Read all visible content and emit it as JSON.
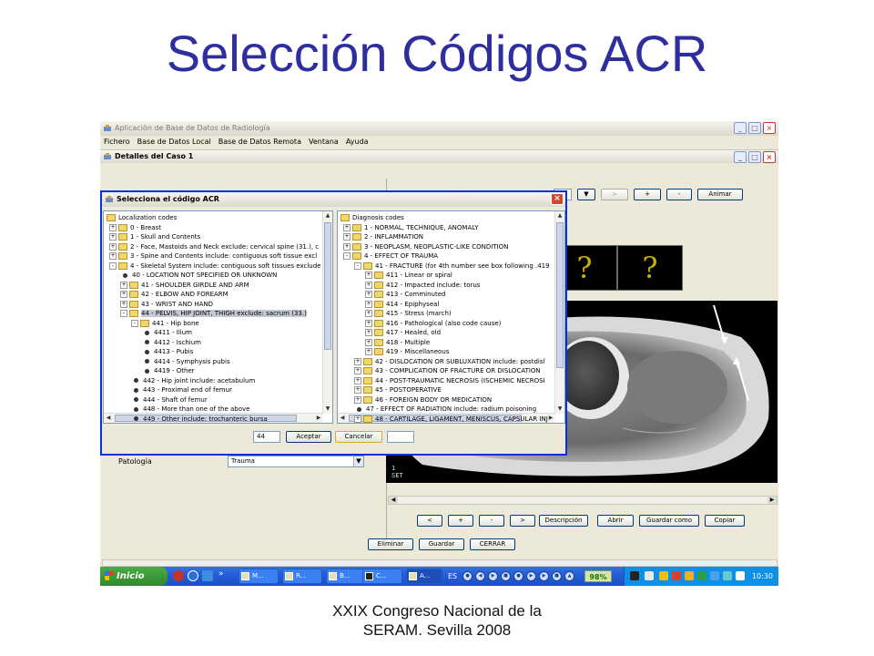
{
  "slide": {
    "title": "Selección Códigos ACR",
    "footer_line1": "XXIX Congreso Nacional de la",
    "footer_line2": "SERAM. Sevilla 2008"
  },
  "app": {
    "title": "Aplicación de Base de Datos de Radiología",
    "menu": [
      "Fichero",
      "Base de Datos Local",
      "Base de Datos Remota",
      "Ventana",
      "Ayuda"
    ],
    "window_buttons": {
      "minimize": "_",
      "maximize": "□",
      "close": "×"
    }
  },
  "case_window": {
    "title": "Detalles del Caso 1",
    "patologia_label": "Patología",
    "patologia_value": "Trauma",
    "image_toolbar": {
      "select_value": "ip",
      "buttons": [
        ">",
        "+",
        "-",
        "Animar"
      ]
    },
    "thumbnails": [
      "?",
      "?"
    ],
    "mri_overlay": "1\nSET",
    "nav_buttons": [
      "<",
      "+",
      "-",
      ">",
      "Descripción",
      "Abrir",
      "Guardar como",
      "Copiar"
    ],
    "bottom_buttons": [
      "Eliminar",
      "Guardar",
      "CERRAR"
    ]
  },
  "dialog": {
    "title": "Selecciona el código ACR",
    "close_label": "×",
    "localization_tree": [
      {
        "text": "Localization codes",
        "level": 0,
        "kind": "root"
      },
      {
        "text": "0 - Breast",
        "level": 1,
        "kind": "folder",
        "toggle": "+"
      },
      {
        "text": "1 - Skull and Contents",
        "level": 1,
        "kind": "folder",
        "toggle": "+"
      },
      {
        "text": "2 - Face, Mastoids and Neck  exclude: cervical spine (31.), c",
        "level": 1,
        "kind": "folder",
        "toggle": "+"
      },
      {
        "text": "3 - Spine and Contents include: contiguous soft tissue   excl",
        "level": 1,
        "kind": "folder",
        "toggle": "+"
      },
      {
        "text": "4 - Skeletal System include: contiguous soft tissues   exclude",
        "level": 1,
        "kind": "folder",
        "toggle": "-"
      },
      {
        "text": "40 - LOCATION NOT SPECIFIED OR UNKNOWN",
        "level": 2,
        "kind": "leaf"
      },
      {
        "text": "41 - SHOULDER GIRDLE AND ARM",
        "level": 2,
        "kind": "folder",
        "toggle": "+"
      },
      {
        "text": "42 - ELBOW AND FOREARM",
        "level": 2,
        "kind": "folder",
        "toggle": "+"
      },
      {
        "text": "43 - WRIST AND HAND",
        "level": 2,
        "kind": "folder",
        "toggle": "+"
      },
      {
        "text": "44 - PELVIS, HIP JOINT, THIGH    exclude: sacrum (33.)",
        "level": 2,
        "kind": "folder",
        "toggle": "-",
        "selected": true
      },
      {
        "text": "441 - Hip bone",
        "level": 3,
        "kind": "folder",
        "toggle": "-"
      },
      {
        "text": "4411 - Ilium",
        "level": 4,
        "kind": "leaf"
      },
      {
        "text": "4412 - Ischium",
        "level": 4,
        "kind": "leaf"
      },
      {
        "text": "4413 - Pubis",
        "level": 4,
        "kind": "leaf"
      },
      {
        "text": "4414 - Symphysis pubis",
        "level": 4,
        "kind": "leaf"
      },
      {
        "text": "4419 - Other",
        "level": 4,
        "kind": "leaf"
      },
      {
        "text": "442 - Hip joint    include: acetabulum",
        "level": 3,
        "kind": "leaf"
      },
      {
        "text": "443 - Proximal end of femur",
        "level": 3,
        "kind": "leaf"
      },
      {
        "text": "444 - Shaft of femur",
        "level": 3,
        "kind": "leaf"
      },
      {
        "text": "448 - More than one of the above",
        "level": 3,
        "kind": "leaf"
      },
      {
        "text": "449 - Other    include: trochanteric bursa",
        "level": 3,
        "kind": "leaf"
      }
    ],
    "diagnosis_tree": [
      {
        "text": "Diagnosis codes",
        "level": 0,
        "kind": "root"
      },
      {
        "text": "1 - NORMAL, TECHNIQUE, ANOMALY",
        "level": 1,
        "kind": "folder",
        "toggle": "+"
      },
      {
        "text": "2 - INFLAMMATION",
        "level": 1,
        "kind": "folder",
        "toggle": "+"
      },
      {
        "text": "3 - NEOPLASM, NEOPLASTIC-LIKE CONDITION",
        "level": 1,
        "kind": "folder",
        "toggle": "+"
      },
      {
        "text": "4 - EFFECT OF TRAUMA",
        "level": 1,
        "kind": "folder",
        "toggle": "-"
      },
      {
        "text": "41 - FRACTURE  (for 4th number see box following .419",
        "level": 2,
        "kind": "folder",
        "toggle": "-"
      },
      {
        "text": "411 - Linear or spiral",
        "level": 3,
        "kind": "folder",
        "toggle": "+"
      },
      {
        "text": "412 - Impacted  include: torus",
        "level": 3,
        "kind": "folder",
        "toggle": "+"
      },
      {
        "text": "413 - Comminuted",
        "level": 3,
        "kind": "folder",
        "toggle": "+"
      },
      {
        "text": "414 - Epiphyseal",
        "level": 3,
        "kind": "folder",
        "toggle": "+"
      },
      {
        "text": "415 - Stress (march)",
        "level": 3,
        "kind": "folder",
        "toggle": "+"
      },
      {
        "text": "416 - Pathological (also code cause)",
        "level": 3,
        "kind": "folder",
        "toggle": "+"
      },
      {
        "text": "417 - Healed, old",
        "level": 3,
        "kind": "folder",
        "toggle": "+"
      },
      {
        "text": "418 - Multiple",
        "level": 3,
        "kind": "folder",
        "toggle": "+"
      },
      {
        "text": "419 - Miscellaneous",
        "level": 3,
        "kind": "folder",
        "toggle": "+"
      },
      {
        "text": "42 - DISLOCATION OR SUBLUXATION   include: postdisl",
        "level": 2,
        "kind": "folder",
        "toggle": "+"
      },
      {
        "text": "43 - COMPLICATION OF FRACTURE OR DISLOCATION",
        "level": 2,
        "kind": "folder",
        "toggle": "+"
      },
      {
        "text": "44 - POST-TRAUMATIC NECROSIS (ISCHEMIC NECROSI",
        "level": 2,
        "kind": "folder",
        "toggle": "+"
      },
      {
        "text": "45 - POSTOPERATIVE",
        "level": 2,
        "kind": "folder",
        "toggle": "+"
      },
      {
        "text": "46 - FOREIGN BODY OR MEDICATION",
        "level": 2,
        "kind": "folder",
        "toggle": "+"
      },
      {
        "text": "47 - EFFECT OF RADIATION   include: radium poisoning",
        "level": 2,
        "kind": "leaf"
      },
      {
        "text": "48 - CARTILAGE, LIGAMENT, MENISCUS, CAPSULAR INJ",
        "level": 2,
        "kind": "folder",
        "toggle": "+"
      }
    ],
    "code_value": "44",
    "accept_label": "Aceptar",
    "cancel_label": "Cancelar"
  },
  "taskbar": {
    "start_label": "Inicio",
    "chevron": "»",
    "tasks": [
      "M...",
      "R...",
      "B...",
      "C...",
      "A..."
    ],
    "lang": "ES",
    "battery": "98%",
    "clock": "10:30"
  }
}
